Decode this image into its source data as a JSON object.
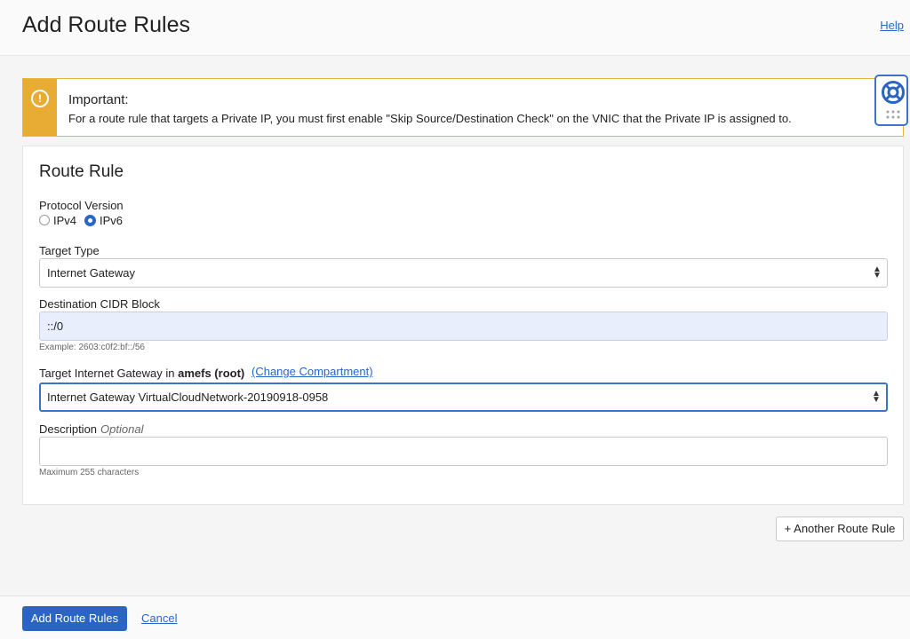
{
  "header": {
    "title": "Add Route Rules",
    "help_label": "Help"
  },
  "alert": {
    "icon": "exclamation-icon",
    "title": "Important:",
    "message": "For a route rule that targets a Private IP, you must first enable \"Skip Source/Destination Check\" on the VNIC that the Private IP is assigned to."
  },
  "help_widget": {
    "icon": "lifebuoy-icon"
  },
  "rule": {
    "title": "Route Rule",
    "protocol": {
      "label": "Protocol Version",
      "options": [
        "IPv4",
        "IPv6"
      ],
      "selected": "IPv6"
    },
    "target_type": {
      "label": "Target Type",
      "value": "Internet Gateway"
    },
    "destination": {
      "label": "Destination CIDR Block",
      "value": "::/0",
      "hint": "Example: 2603:c0f2:bf::/56"
    },
    "target_gateway": {
      "label_prefix": "Target Internet Gateway in",
      "compartment": "amefs (root)",
      "change_label": "(Change Compartment)",
      "value": "Internet Gateway VirtualCloudNetwork-20190918-0958"
    },
    "description": {
      "label": "Description",
      "optional_label": "Optional",
      "value": "",
      "hint": "Maximum 255 characters"
    }
  },
  "another_rule_label": "+ Another Route Rule",
  "footer": {
    "submit_label": "Add Route Rules",
    "cancel_label": "Cancel"
  },
  "colors": {
    "primary": "#2b65c4",
    "warning": "#e8ab34",
    "link": "#2966c8"
  }
}
